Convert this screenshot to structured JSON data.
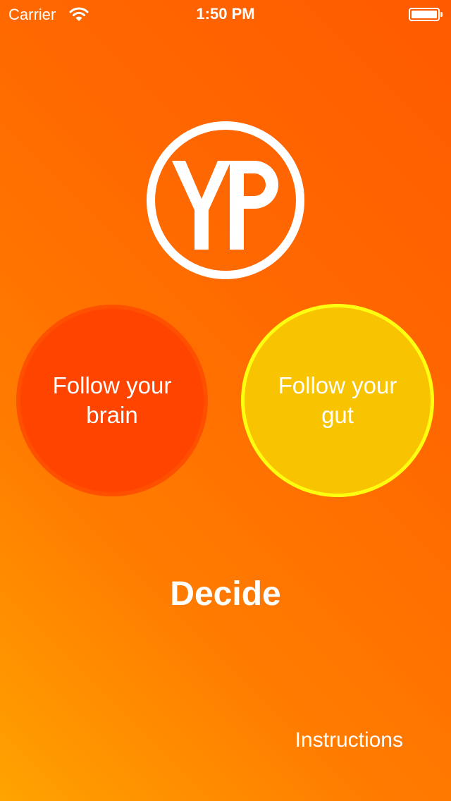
{
  "status_bar": {
    "carrier": "Carrier",
    "time": "1:50 PM",
    "wifi_icon": "wifi-icon",
    "battery_icon": "battery-full-icon",
    "battery_level": 1.0
  },
  "logo": {
    "text": "YP",
    "icon": "yp-circle-logo"
  },
  "choices": {
    "brain": {
      "label": "Follow your\nbrain",
      "color": "#ff4400"
    },
    "gut": {
      "label": "Follow your\ngut",
      "color": "#f8c300",
      "selected": true,
      "outline_color": "#ffff10"
    }
  },
  "decide_label": "Decide",
  "instructions_label": "Instructions",
  "colors": {
    "background_top": "#ff5a00",
    "background_bottom": "#ffa400",
    "text": "#ffffff"
  }
}
